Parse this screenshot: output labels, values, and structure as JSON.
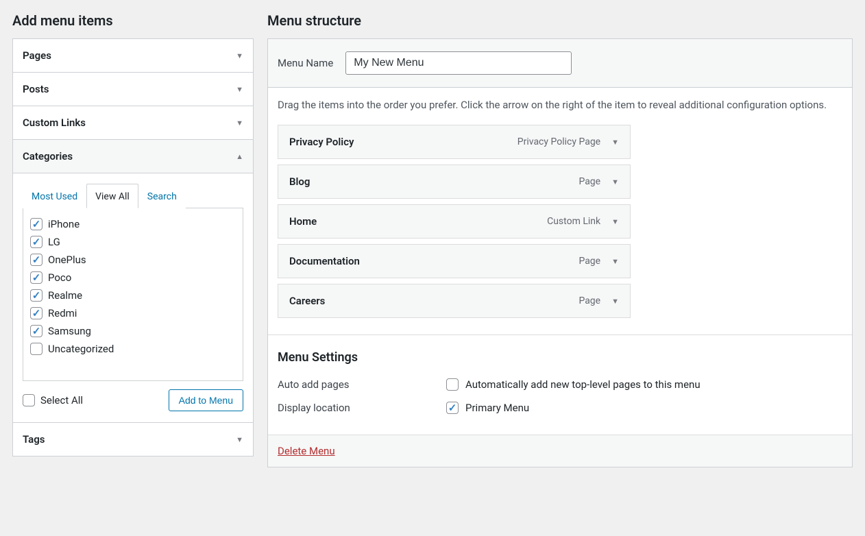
{
  "left": {
    "heading": "Add menu items",
    "sections": {
      "pages": "Pages",
      "posts": "Posts",
      "custom_links": "Custom Links",
      "categories": "Categories",
      "tags": "Tags"
    },
    "tabs": {
      "most_used": "Most Used",
      "view_all": "View All",
      "search": "Search"
    },
    "categories_list": [
      {
        "label": "iPhone",
        "checked": true
      },
      {
        "label": "LG",
        "checked": true
      },
      {
        "label": "OnePlus",
        "checked": true
      },
      {
        "label": "Poco",
        "checked": true
      },
      {
        "label": "Realme",
        "checked": true
      },
      {
        "label": "Redmi",
        "checked": true
      },
      {
        "label": "Samsung",
        "checked": true
      },
      {
        "label": "Uncategorized",
        "checked": false
      }
    ],
    "select_all": "Select All",
    "add_to_menu": "Add to Menu"
  },
  "right": {
    "heading": "Menu structure",
    "menu_name_label": "Menu Name",
    "menu_name_value": "My New Menu",
    "hint": "Drag the items into the order you prefer. Click the arrow on the right of the item to reveal additional configuration options.",
    "items": [
      {
        "title": "Privacy Policy",
        "type": "Privacy Policy Page"
      },
      {
        "title": "Blog",
        "type": "Page"
      },
      {
        "title": "Home",
        "type": "Custom Link"
      },
      {
        "title": "Documentation",
        "type": "Page"
      },
      {
        "title": "Careers",
        "type": "Page"
      }
    ],
    "settings": {
      "title": "Menu Settings",
      "auto_add_label": "Auto add pages",
      "auto_add_desc": "Automatically add new top-level pages to this menu",
      "display_loc_label": "Display location",
      "display_loc_desc": "Primary Menu"
    },
    "delete": "Delete Menu"
  }
}
